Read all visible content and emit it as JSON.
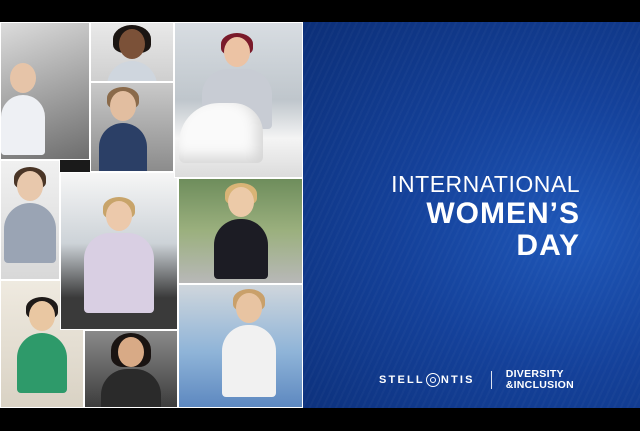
{
  "panel": {
    "title_line1": "INTERNATIONAL",
    "title_line2": "WOMEN’S",
    "title_line3": "DAY",
    "brand_left": "STELL",
    "brand_right": "NTIS",
    "di_line1": "DIVERSITY",
    "di_line2": "&INCLUSION",
    "background_color": "#14419a"
  },
  "collage": {
    "tile_count": 10
  }
}
